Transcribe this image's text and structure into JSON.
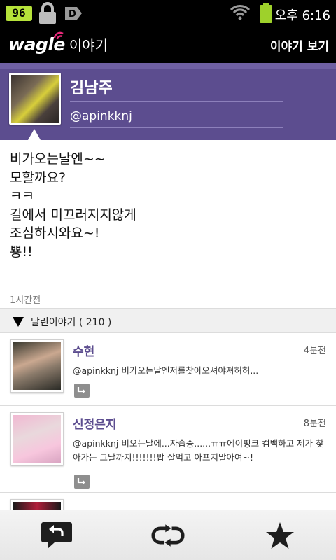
{
  "status_bar": {
    "battery_badge": "96",
    "time": "오후 6:16",
    "icons": [
      "battery-level-icon",
      "lock-icon",
      "notification-d-icon",
      "wifi-icon",
      "battery-icon"
    ]
  },
  "title_bar": {
    "logo_text": "wagle",
    "logo_sub": "이야기",
    "view_button": "이야기 보기"
  },
  "profile": {
    "name": "김남주",
    "handle": "@apinkknj"
  },
  "message": {
    "lines": [
      "비가오는날엔~~",
      "모할까요?",
      "ㅋㅋ",
      "길에서 미끄러지지않게",
      "조심하시와요~!",
      "뿅!!"
    ],
    "time": "1시간전"
  },
  "replies": {
    "header": "달린이야기 ( 210 )",
    "items": [
      {
        "name": "수현",
        "time": "4분전",
        "text": "@apinkknj 비가오는날엔저를찾아오셔야져허허..."
      },
      {
        "name": "신정은지",
        "time": "8분전",
        "text": "@apinkknj 비오는날에...자습중......ㅠㅠ에이핑크 컴백하고 제가 찾아가는 그날까지!!!!!!!밥 잘먹고 아프지말아여~!"
      }
    ]
  },
  "bottom_bar": {
    "icons": [
      "reply-icon",
      "repost-icon",
      "favorite-star-icon"
    ]
  },
  "colors": {
    "header_purple": "#5c4d8f",
    "name_purple": "#5c4d8f",
    "accent_pink": "#e8297a",
    "battery_green": "#9ed12b"
  }
}
